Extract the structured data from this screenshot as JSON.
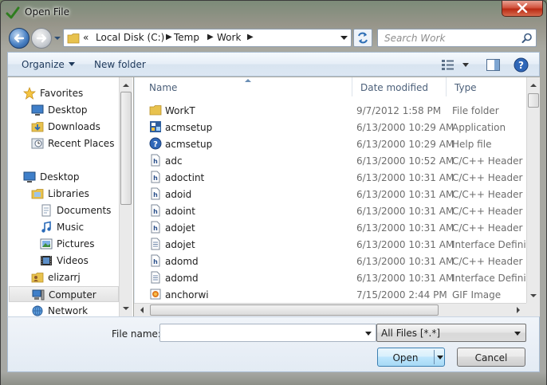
{
  "window": {
    "title": "Open File"
  },
  "address": {
    "overflow": "«",
    "crumbs": [
      "Local Disk (C:)",
      "Temp",
      "Work"
    ]
  },
  "search": {
    "placeholder": "Search Work"
  },
  "toolbar": {
    "organize": "Organize",
    "new_folder": "New folder"
  },
  "nav": {
    "favorites": "Favorites",
    "desktop_fav": "Desktop",
    "downloads": "Downloads",
    "recent": "Recent Places",
    "desktop": "Desktop",
    "libraries": "Libraries",
    "documents": "Documents",
    "music": "Music",
    "pictures": "Pictures",
    "videos": "Videos",
    "user": "elizarrj",
    "computer": "Computer",
    "network": "Network"
  },
  "columns": {
    "name": "Name",
    "date": "Date modified",
    "type": "Type"
  },
  "files": [
    {
      "name": "WorkT",
      "date": "9/7/2012 1:58 PM",
      "type": "File folder",
      "icon": "folder-icon"
    },
    {
      "name": "acmsetup",
      "date": "6/13/2000 10:29 AM",
      "type": "Application",
      "icon": "application-icon"
    },
    {
      "name": "acmsetup",
      "date": "6/13/2000 10:29 AM",
      "type": "Help file",
      "icon": "help-file-icon"
    },
    {
      "name": "adc",
      "date": "6/13/2000 10:52 AM",
      "type": "C/C++ Header",
      "icon": "header-file-icon"
    },
    {
      "name": "adoctint",
      "date": "6/13/2000 10:31 AM",
      "type": "C/C++ Header",
      "icon": "header-file-icon"
    },
    {
      "name": "adoid",
      "date": "6/13/2000 10:31 AM",
      "type": "C/C++ Header",
      "icon": "header-file-icon"
    },
    {
      "name": "adoint",
      "date": "6/13/2000 10:31 AM",
      "type": "C/C++ Header",
      "icon": "header-file-icon"
    },
    {
      "name": "adojet",
      "date": "6/13/2000 10:31 AM",
      "type": "C/C++ Header",
      "icon": "header-file-icon"
    },
    {
      "name": "adojet",
      "date": "6/13/2000 10:31 AM",
      "type": "Interface Definition",
      "icon": "idl-file-icon"
    },
    {
      "name": "adomd",
      "date": "6/13/2000 10:31 AM",
      "type": "C/C++ Header",
      "icon": "header-file-icon"
    },
    {
      "name": "adomd",
      "date": "6/13/2000 10:31 AM",
      "type": "Interface Definition",
      "icon": "idl-file-icon"
    },
    {
      "name": "anchorwi",
      "date": "7/15/2000 2:44 PM",
      "type": "GIF Image",
      "icon": "gif-image-icon"
    }
  ],
  "bottom": {
    "file_name_label": "File name:",
    "file_name_value": "",
    "filter": "All Files [*.*]",
    "open": "Open",
    "cancel": "Cancel"
  }
}
